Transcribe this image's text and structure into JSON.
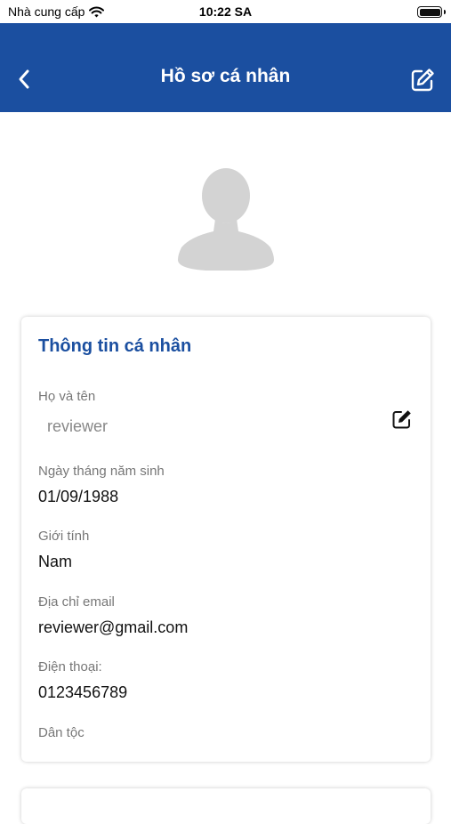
{
  "status_bar": {
    "carrier": "Nhà cung cấp",
    "time": "10:22 SA"
  },
  "header": {
    "title": "Hồ sơ cá nhân"
  },
  "profile": {
    "section_title": "Thông tin cá nhân",
    "full_name": {
      "label": "Họ và tên",
      "value": "reviewer"
    },
    "birth_date": {
      "label": "Ngày tháng năm sinh",
      "value": "01/09/1988"
    },
    "gender": {
      "label": "Giới tính",
      "value": "Nam"
    },
    "email": {
      "label": "Địa chỉ email",
      "value": "reviewer@gmail.com"
    },
    "phone": {
      "label": "Điện thoại:",
      "value": "0123456789"
    },
    "ethnicity": {
      "label": "Dân tộc",
      "value": ""
    }
  },
  "colors": {
    "brand_blue": "#1b4fa0",
    "label_gray": "#777777",
    "avatar_gray": "#d3d3d3"
  },
  "icons": {
    "back": "chevron-left-icon",
    "edit": "edit-icon",
    "wifi": "wifi-icon",
    "battery": "battery-icon",
    "avatar": "user-avatar-icon"
  }
}
